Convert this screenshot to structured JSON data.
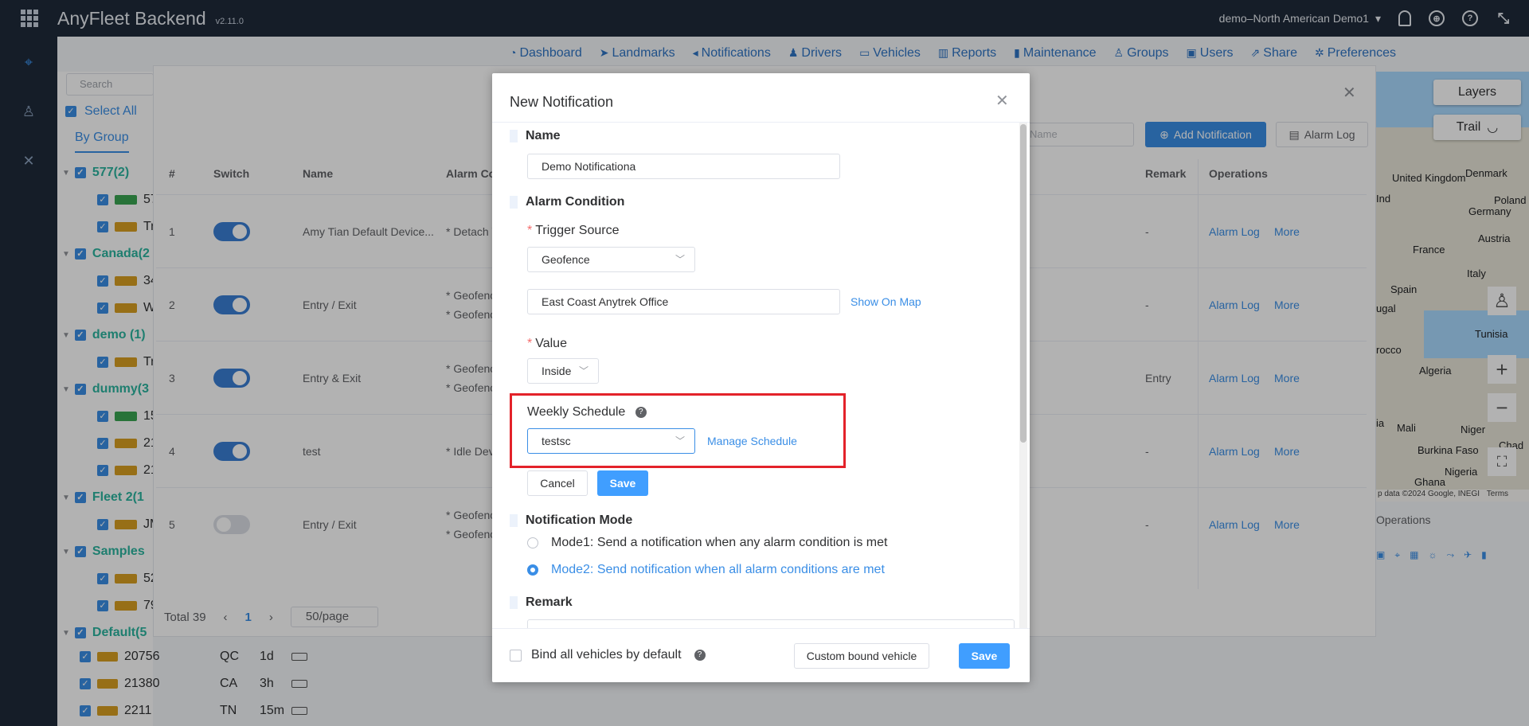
{
  "app": {
    "brand": "AnyFleet Backend",
    "version": "v2.11.0",
    "account": "demo–North American Demo1"
  },
  "nav": {
    "items": [
      {
        "icon": "dashboard-icon",
        "label": "Dashboard"
      },
      {
        "icon": "landmarks-icon",
        "label": "Landmarks"
      },
      {
        "icon": "notifications-icon",
        "label": "Notifications"
      },
      {
        "icon": "drivers-icon",
        "label": "Drivers"
      },
      {
        "icon": "vehicles-icon",
        "label": "Vehicles"
      },
      {
        "icon": "reports-icon",
        "label": "Reports"
      },
      {
        "icon": "maintenance-icon",
        "label": "Maintenance"
      },
      {
        "icon": "groups-icon",
        "label": "Groups"
      },
      {
        "icon": "users-icon",
        "label": "Users"
      },
      {
        "icon": "share-icon",
        "label": "Share"
      },
      {
        "icon": "preferences-icon",
        "label": "Preferences"
      }
    ]
  },
  "sidebar": {
    "search_placeholder": "Search",
    "select_all": "Select All",
    "by_group": "By Group",
    "tree": [
      {
        "type": "group",
        "label": "577(2)"
      },
      {
        "type": "item",
        "label": "57",
        "color": "#3aa552"
      },
      {
        "type": "item",
        "label": "Tru",
        "color": "#d9a021"
      },
      {
        "type": "group",
        "label": "Canada(2"
      },
      {
        "type": "item",
        "label": "34",
        "color": "#d9a021"
      },
      {
        "type": "item",
        "label": "W3",
        "color": "#d9a021"
      },
      {
        "type": "group",
        "label": "demo (1)"
      },
      {
        "type": "item",
        "label": "Tru",
        "color": "#d9a021"
      },
      {
        "type": "group",
        "label": "dummy(3"
      },
      {
        "type": "item",
        "label": "15",
        "color": "#3aa552"
      },
      {
        "type": "item",
        "label": "21",
        "color": "#d9a021"
      },
      {
        "type": "item",
        "label": "21",
        "color": "#d9a021"
      },
      {
        "type": "group",
        "label": "Fleet 2(1"
      },
      {
        "type": "item",
        "label": "JM",
        "color": "#d9a021"
      },
      {
        "type": "group",
        "label": "Samples"
      },
      {
        "type": "item",
        "label": "52",
        "color": "#d9a021"
      },
      {
        "type": "item",
        "label": "79",
        "color": "#d9a021"
      },
      {
        "type": "group",
        "label": "Default(5"
      }
    ],
    "bottom_rows": [
      {
        "name": "20756",
        "state": "QC",
        "time": "1d"
      },
      {
        "name": "21380",
        "state": "CA",
        "time": "3h"
      },
      {
        "name": "2211",
        "state": "TN",
        "time": "15m"
      }
    ]
  },
  "notifications_panel": {
    "name_placeholder": "Name",
    "add_button": "Add Notification",
    "alarm_log_button": "Alarm Log",
    "columns": {
      "index": "#",
      "switch": "Switch",
      "name": "Name",
      "alarm": "Alarm Co",
      "remark": "Remark",
      "operations": "Operations"
    },
    "rows": [
      {
        "index": "1",
        "on": true,
        "name": "Amy Tian Default Device...",
        "alarm1": "* Detach V",
        "alarm2": "",
        "remark": "-",
        "log": "Alarm Log",
        "more": "More"
      },
      {
        "index": "2",
        "on": true,
        "name": "Entry / Exit",
        "alarm1": "* Geofenc",
        "alarm2": "* Geofenc",
        "remark": "-",
        "log": "Alarm Log",
        "more": "More"
      },
      {
        "index": "3",
        "on": true,
        "name": "Entry & Exit",
        "alarm1": "* Geofenc",
        "alarm2": "* Geofenc",
        "remark": "Entry",
        "log": "Alarm Log",
        "more": "More"
      },
      {
        "index": "4",
        "on": true,
        "name": "test",
        "alarm1": "* Idle Dev",
        "alarm2": "",
        "remark": "-",
        "log": "Alarm Log",
        "more": "More"
      },
      {
        "index": "5",
        "on": false,
        "name": "Entry / Exit",
        "alarm1": "* Geofenc",
        "alarm2": "* Geofenc",
        "remark": "-",
        "log": "Alarm Log",
        "more": "More"
      }
    ],
    "pager": {
      "total": "Total 39",
      "page": "1",
      "page_size": "50/page"
    }
  },
  "map": {
    "layers": "Layers",
    "trail": "Trail",
    "labels": [
      "United Kingdom",
      "Denmark",
      "Germany",
      "Poland",
      "France",
      "Austria",
      "Italy",
      "Spain",
      "Tunisia",
      "Algeria",
      "Mali",
      "Niger",
      "Chad",
      "Burkina Faso",
      "Nigeria",
      "Ghana",
      "rocco",
      "ugal",
      "ia",
      "Ind"
    ],
    "footer": "p data ©2024 Google, INEGI",
    "terms": "Terms",
    "operations": "Operations"
  },
  "modal": {
    "title": "New Notification",
    "sections": {
      "name": "Name",
      "alarm_condition": "Alarm Condition",
      "notification_mode": "Notification Mode",
      "remark": "Remark"
    },
    "name_value": "Demo Notificationa",
    "trigger_source_label": "Trigger Source",
    "trigger_source_value": "Geofence",
    "geofence_value": "East Coast Anytrek Office",
    "show_on_map": "Show On Map",
    "value_label": "Value",
    "value_value": "Inside",
    "weekly_schedule_label": "Weekly Schedule",
    "weekly_schedule_value": "testsc",
    "manage_schedule": "Manage Schedule",
    "cancel": "Cancel",
    "save_inline": "Save",
    "mode1": "Mode1: Send a notification when any alarm condition is met",
    "mode2": "Mode2: Send notification when all alarm conditions are met",
    "selected_mode": "mode2",
    "bind_all": "Bind all vehicles by default",
    "custom_bound": "Custom bound vehicle",
    "save": "Save"
  },
  "colors": {
    "accent": "#409eff",
    "highlight": "#e3222a",
    "topbar": "#1f2a3a",
    "group": "#2cb5a0"
  }
}
